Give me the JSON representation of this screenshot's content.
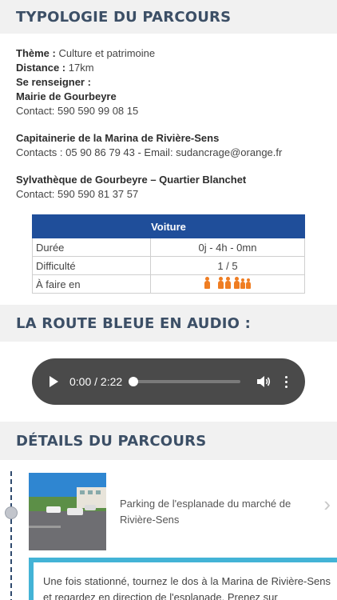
{
  "typologie": {
    "title": "TYPOLOGIE DU PARCOURS",
    "theme_label": "Thème :",
    "theme_value": "Culture et patrimoine",
    "distance_label": "Distance :",
    "distance_value": "17km",
    "renseigner_label": "Se renseigner :",
    "contacts": [
      {
        "name": "Mairie de Gourbeyre",
        "line": "Contact: 590 590 99 08 15"
      },
      {
        "name": "Capitainerie de la Marina de Rivière-Sens",
        "line": "Contacts : 05 90 86 79 43 - Email: sudancrage@orange.fr"
      },
      {
        "name": "Sylvathèque de Gourbeyre – Quartier Blanchet",
        "line": "Contact: 590 590 81 37 57"
      }
    ]
  },
  "trip_table": {
    "header": "Voiture",
    "rows": [
      {
        "label": "Durée",
        "value": "0j - 4h - 0mn"
      },
      {
        "label": "Difficulté",
        "value": "1 / 5"
      },
      {
        "label": "À faire en",
        "value": ""
      }
    ],
    "people_icons": [
      "person-icon",
      "couple-icon",
      "group-icon"
    ],
    "accent_color": "#ef7d22"
  },
  "audio": {
    "title": "LA ROUTE BLEUE EN AUDIO :",
    "time": "0:00 / 2:22",
    "progress": 0
  },
  "details": {
    "title": "DÉTAILS DU PARCOURS",
    "step_caption": "Parking de l'esplanade du marché de Rivière-Sens",
    "description": "Une fois stationné, tournez le dos à la Marina de Rivière-Sens et regardez en direction de l'esplanade. Prenez sur"
  },
  "colors": {
    "header_bg": "#f1f1f1",
    "header_text": "#3c4f66",
    "table_header": "#1f4e9a",
    "desc_border": "#43b3d6"
  }
}
